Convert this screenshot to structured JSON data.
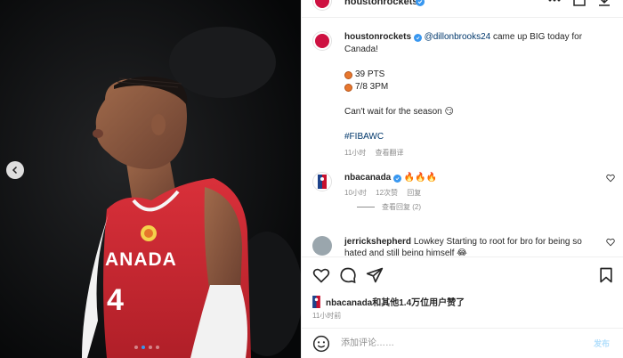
{
  "post": {
    "account": "houstonrockets",
    "mention": "@dillonbrooks24",
    "caption_rest": " came up BIG today for Canada!",
    "stat_pts": "39 PTS",
    "stat_3pm": "7/8 3PM",
    "caption_line2": "Can't wait for the season 😏",
    "hashtag": "#FIBAWC",
    "time": "11小时",
    "see_translation": "查看翻译",
    "like_count_prefix": "nbacanada",
    "like_count_rest": "和其他1.4万位用户赞了",
    "posted_ago": "11小时前"
  },
  "photo": {
    "jersey_text": "ANADA",
    "jersey_number": "4"
  },
  "comments": [
    {
      "user": "nbacanada",
      "text": "🔥🔥🔥",
      "time": "10小时",
      "likes": "12次赞",
      "reply": "回复",
      "view_replies": "查看回复 (2)"
    },
    {
      "user": "jerrickshepherd",
      "text": "Lowkey Starting to root for bro for being so hated and still being himself 😂"
    }
  ],
  "add_comment": {
    "placeholder": "添加评论……",
    "post_label": "发布"
  },
  "colors": {
    "verified_blue": "#3897f0",
    "link_blue": "#00376b",
    "rockets_red": "#ce1141",
    "jersey_red": "#d42a2f"
  },
  "icons": [
    "chevron-left-icon",
    "heart-icon",
    "comment-icon",
    "share-icon",
    "bookmark-icon",
    "emoji-icon",
    "more-icon",
    "download-icon",
    "save-corner-icon",
    "verified-icon"
  ]
}
